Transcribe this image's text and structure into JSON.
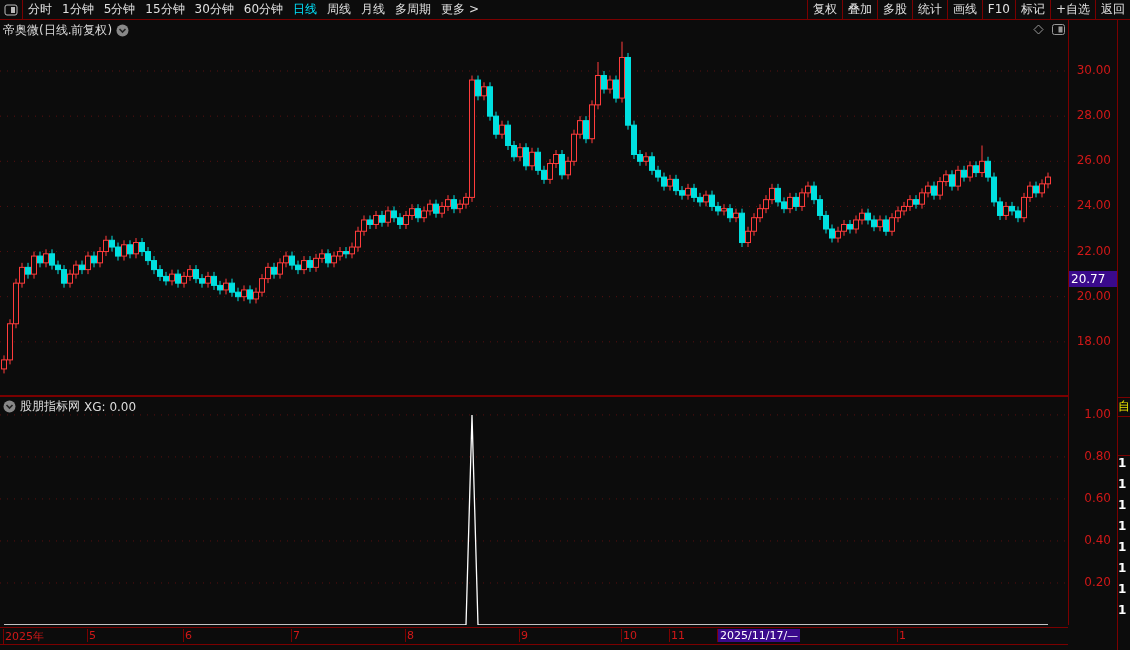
{
  "toolbar": {
    "periods": [
      {
        "label": "分时",
        "selected": false
      },
      {
        "label": "1分钟",
        "selected": false
      },
      {
        "label": "5分钟",
        "selected": false
      },
      {
        "label": "15分钟",
        "selected": false
      },
      {
        "label": "30分钟",
        "selected": false
      },
      {
        "label": "60分钟",
        "selected": false
      },
      {
        "label": "日线",
        "selected": true
      },
      {
        "label": "周线",
        "selected": false
      },
      {
        "label": "月线",
        "selected": false
      },
      {
        "label": "多周期",
        "selected": false
      },
      {
        "label": "更多 >",
        "selected": false
      }
    ],
    "actions": [
      "复权",
      "叠加",
      "多股",
      "统计",
      "画线",
      "F10",
      "标记",
      "+自选",
      "返回"
    ]
  },
  "main_panel": {
    "title": "帝奥微(日线.前复权)",
    "last_price": "20.77",
    "chart_data": {
      "type": "candlestick",
      "grid": true,
      "ylim": [
        15.6,
        32.26
      ],
      "yticks": [
        {
          "value": 30,
          "label": "30.00"
        },
        {
          "value": 28,
          "label": "28.00"
        },
        {
          "value": 26,
          "label": "26.00"
        },
        {
          "value": 24,
          "label": "24.00"
        },
        {
          "value": 22,
          "label": "22.00"
        },
        {
          "value": 20,
          "label": "20.00"
        },
        {
          "value": 18,
          "label": "18.00"
        }
      ],
      "ohlc": [
        [
          16.8,
          17.4,
          16.6,
          17.2
        ],
        [
          17.2,
          19.0,
          17.0,
          18.8
        ],
        [
          18.8,
          20.8,
          18.6,
          20.6
        ],
        [
          20.6,
          21.5,
          20.4,
          21.3
        ],
        [
          21.3,
          21.5,
          20.8,
          21.0
        ],
        [
          21.0,
          22.0,
          20.8,
          21.8
        ],
        [
          21.8,
          22.0,
          21.3,
          21.5
        ],
        [
          21.5,
          22.1,
          21.3,
          21.9
        ],
        [
          21.9,
          22.1,
          21.2,
          21.4
        ],
        [
          21.4,
          21.6,
          21.0,
          21.2
        ],
        [
          21.2,
          21.4,
          20.4,
          20.6
        ],
        [
          20.6,
          21.2,
          20.4,
          21.0
        ],
        [
          21.0,
          21.6,
          20.8,
          21.4
        ],
        [
          21.4,
          21.6,
          21.0,
          21.2
        ],
        [
          21.2,
          22.0,
          21.0,
          21.8
        ],
        [
          21.8,
          22.0,
          21.3,
          21.5
        ],
        [
          21.5,
          22.2,
          21.3,
          22.0
        ],
        [
          22.0,
          22.7,
          21.8,
          22.5
        ],
        [
          22.5,
          22.7,
          22.0,
          22.2
        ],
        [
          22.2,
          22.4,
          21.6,
          21.8
        ],
        [
          21.8,
          22.5,
          21.6,
          22.3
        ],
        [
          22.3,
          22.5,
          21.7,
          21.9
        ],
        [
          21.9,
          22.6,
          21.7,
          22.4
        ],
        [
          22.4,
          22.6,
          21.8,
          22.0
        ],
        [
          22.0,
          22.2,
          21.4,
          21.6
        ],
        [
          21.6,
          21.8,
          21.0,
          21.2
        ],
        [
          21.2,
          21.4,
          20.7,
          20.9
        ],
        [
          20.9,
          21.1,
          20.5,
          20.7
        ],
        [
          20.7,
          21.2,
          20.5,
          21.0
        ],
        [
          21.0,
          21.2,
          20.4,
          20.6
        ],
        [
          20.6,
          21.1,
          20.4,
          20.9
        ],
        [
          20.9,
          21.4,
          20.7,
          21.2
        ],
        [
          21.2,
          21.4,
          20.6,
          20.8
        ],
        [
          20.8,
          21.0,
          20.4,
          20.6
        ],
        [
          20.6,
          21.1,
          20.4,
          20.9
        ],
        [
          20.9,
          21.1,
          20.3,
          20.5
        ],
        [
          20.5,
          20.7,
          20.1,
          20.3
        ],
        [
          20.3,
          20.8,
          20.1,
          20.6
        ],
        [
          20.6,
          20.8,
          20.0,
          20.2
        ],
        [
          20.2,
          20.4,
          19.8,
          20.0
        ],
        [
          20.0,
          20.5,
          19.8,
          20.3
        ],
        [
          20.3,
          20.5,
          19.7,
          19.9
        ],
        [
          19.9,
          20.4,
          19.7,
          20.2
        ],
        [
          20.2,
          21.0,
          20.0,
          20.8
        ],
        [
          20.8,
          21.5,
          20.6,
          21.3
        ],
        [
          21.3,
          21.5,
          20.8,
          21.0
        ],
        [
          21.0,
          21.7,
          20.8,
          21.5
        ],
        [
          21.5,
          22.0,
          21.3,
          21.8
        ],
        [
          21.8,
          22.0,
          21.2,
          21.4
        ],
        [
          21.4,
          21.6,
          21.0,
          21.2
        ],
        [
          21.2,
          21.8,
          21.0,
          21.6
        ],
        [
          21.6,
          21.8,
          21.1,
          21.3
        ],
        [
          21.3,
          21.9,
          21.1,
          21.7
        ],
        [
          21.7,
          22.1,
          21.5,
          21.9
        ],
        [
          21.9,
          22.1,
          21.3,
          21.5
        ],
        [
          21.5,
          22.0,
          21.3,
          21.8
        ],
        [
          21.8,
          22.2,
          21.6,
          22.0
        ],
        [
          22.0,
          22.2,
          21.7,
          21.9
        ],
        [
          21.9,
          22.4,
          21.7,
          22.2
        ],
        [
          22.2,
          23.1,
          22.0,
          22.9
        ],
        [
          22.9,
          23.6,
          22.7,
          23.4
        ],
        [
          23.4,
          23.6,
          23.0,
          23.2
        ],
        [
          23.2,
          23.8,
          23.0,
          23.6
        ],
        [
          23.6,
          23.8,
          23.1,
          23.3
        ],
        [
          23.3,
          24.0,
          23.1,
          23.8
        ],
        [
          23.8,
          24.0,
          23.3,
          23.5
        ],
        [
          23.5,
          23.7,
          23.0,
          23.2
        ],
        [
          23.2,
          23.8,
          23.0,
          23.6
        ],
        [
          23.6,
          24.1,
          23.4,
          23.9
        ],
        [
          23.9,
          24.1,
          23.3,
          23.5
        ],
        [
          23.5,
          24.0,
          23.3,
          23.8
        ],
        [
          23.8,
          24.3,
          23.6,
          24.1
        ],
        [
          24.1,
          24.3,
          23.5,
          23.7
        ],
        [
          23.7,
          24.2,
          23.5,
          24.0
        ],
        [
          24.0,
          24.5,
          23.8,
          24.3
        ],
        [
          24.3,
          24.5,
          23.7,
          23.9
        ],
        [
          23.9,
          24.3,
          23.7,
          24.1
        ],
        [
          24.1,
          24.6,
          23.9,
          24.4
        ],
        [
          24.4,
          29.8,
          24.2,
          29.6
        ],
        [
          29.6,
          29.8,
          28.7,
          28.9
        ],
        [
          28.9,
          29.5,
          28.7,
          29.3
        ],
        [
          29.3,
          29.5,
          27.8,
          28.0
        ],
        [
          28.0,
          28.2,
          27.0,
          27.2
        ],
        [
          27.2,
          27.8,
          27.0,
          27.6
        ],
        [
          27.6,
          27.8,
          26.5,
          26.7
        ],
        [
          26.7,
          26.9,
          26.0,
          26.2
        ],
        [
          26.2,
          26.8,
          26.0,
          26.6
        ],
        [
          26.6,
          26.8,
          25.6,
          25.8
        ],
        [
          25.8,
          26.6,
          25.6,
          26.4
        ],
        [
          26.4,
          26.6,
          25.4,
          25.6
        ],
        [
          25.6,
          25.8,
          25.0,
          25.2
        ],
        [
          25.2,
          26.1,
          25.0,
          25.9
        ],
        [
          25.9,
          26.5,
          25.7,
          26.3
        ],
        [
          26.3,
          26.5,
          25.2,
          25.4
        ],
        [
          25.4,
          26.2,
          25.2,
          26.0
        ],
        [
          26.0,
          27.4,
          25.8,
          27.2
        ],
        [
          27.2,
          28.0,
          27.0,
          27.8
        ],
        [
          27.8,
          28.0,
          26.8,
          27.0
        ],
        [
          27.0,
          28.7,
          26.8,
          28.5
        ],
        [
          28.5,
          30.4,
          28.3,
          29.8
        ],
        [
          29.8,
          30.0,
          29.0,
          29.2
        ],
        [
          29.2,
          29.8,
          29.0,
          29.6
        ],
        [
          29.6,
          29.8,
          28.6,
          28.8
        ],
        [
          28.8,
          31.3,
          28.6,
          30.6
        ],
        [
          30.6,
          30.8,
          27.4,
          27.6
        ],
        [
          27.6,
          27.8,
          26.1,
          26.3
        ],
        [
          26.3,
          26.5,
          25.8,
          26.0
        ],
        [
          26.0,
          26.4,
          25.8,
          26.2
        ],
        [
          26.2,
          26.4,
          25.4,
          25.6
        ],
        [
          25.6,
          25.8,
          25.1,
          25.3
        ],
        [
          25.3,
          25.5,
          24.7,
          24.9
        ],
        [
          24.9,
          25.4,
          24.7,
          25.2
        ],
        [
          25.2,
          25.4,
          24.5,
          24.7
        ],
        [
          24.7,
          24.9,
          24.3,
          24.5
        ],
        [
          24.5,
          25.0,
          24.3,
          24.8
        ],
        [
          24.8,
          25.0,
          24.2,
          24.4
        ],
        [
          24.4,
          24.6,
          24.0,
          24.2
        ],
        [
          24.2,
          24.7,
          24.0,
          24.5
        ],
        [
          24.5,
          24.7,
          23.8,
          24.0
        ],
        [
          24.0,
          24.2,
          23.6,
          23.8
        ],
        [
          23.8,
          24.1,
          23.6,
          23.9
        ],
        [
          23.9,
          24.1,
          23.3,
          23.5
        ],
        [
          23.5,
          23.9,
          23.3,
          23.7
        ],
        [
          23.7,
          23.9,
          22.2,
          22.4
        ],
        [
          22.4,
          23.1,
          22.2,
          22.9
        ],
        [
          22.9,
          23.7,
          22.7,
          23.5
        ],
        [
          23.5,
          24.1,
          23.3,
          23.9
        ],
        [
          23.9,
          24.5,
          23.7,
          24.3
        ],
        [
          24.3,
          25.0,
          24.1,
          24.8
        ],
        [
          24.8,
          25.0,
          24.0,
          24.2
        ],
        [
          24.2,
          24.4,
          23.7,
          23.9
        ],
        [
          23.9,
          24.6,
          23.7,
          24.4
        ],
        [
          24.4,
          24.6,
          23.8,
          24.0
        ],
        [
          24.0,
          24.8,
          23.8,
          24.6
        ],
        [
          24.6,
          25.1,
          24.4,
          24.9
        ],
        [
          24.9,
          25.1,
          24.1,
          24.3
        ],
        [
          24.3,
          24.5,
          23.4,
          23.6
        ],
        [
          23.6,
          23.8,
          22.8,
          23.0
        ],
        [
          23.0,
          23.2,
          22.4,
          22.6
        ],
        [
          22.6,
          23.1,
          22.4,
          22.9
        ],
        [
          22.9,
          23.4,
          22.7,
          23.2
        ],
        [
          23.2,
          23.4,
          22.8,
          23.0
        ],
        [
          23.0,
          23.6,
          22.8,
          23.4
        ],
        [
          23.4,
          23.9,
          23.2,
          23.7
        ],
        [
          23.7,
          23.9,
          23.2,
          23.4
        ],
        [
          23.4,
          23.6,
          22.9,
          23.1
        ],
        [
          23.1,
          23.6,
          22.9,
          23.4
        ],
        [
          23.4,
          23.6,
          22.7,
          22.9
        ],
        [
          22.9,
          23.7,
          22.7,
          23.5
        ],
        [
          23.5,
          24.0,
          23.3,
          23.8
        ],
        [
          23.8,
          24.2,
          23.6,
          24.0
        ],
        [
          24.0,
          24.5,
          23.8,
          24.3
        ],
        [
          24.3,
          24.5,
          23.9,
          24.1
        ],
        [
          24.1,
          24.8,
          23.9,
          24.6
        ],
        [
          24.6,
          25.1,
          24.4,
          24.9
        ],
        [
          24.9,
          25.1,
          24.3,
          24.5
        ],
        [
          24.5,
          25.3,
          24.3,
          25.1
        ],
        [
          25.1,
          25.6,
          24.9,
          25.4
        ],
        [
          25.4,
          25.6,
          24.7,
          24.9
        ],
        [
          24.9,
          25.8,
          24.7,
          25.6
        ],
        [
          25.6,
          25.8,
          25.1,
          25.3
        ],
        [
          25.3,
          26.0,
          25.1,
          25.8
        ],
        [
          25.8,
          26.0,
          25.3,
          25.5
        ],
        [
          25.5,
          26.7,
          25.3,
          26.0
        ],
        [
          26.0,
          26.2,
          25.1,
          25.3
        ],
        [
          25.3,
          25.5,
          24.0,
          24.2
        ],
        [
          24.2,
          24.4,
          23.4,
          23.6
        ],
        [
          23.6,
          24.2,
          23.4,
          24.0
        ],
        [
          24.0,
          24.2,
          23.6,
          23.8
        ],
        [
          23.8,
          24.0,
          23.3,
          23.5
        ],
        [
          23.5,
          24.6,
          23.3,
          24.4
        ],
        [
          24.4,
          25.1,
          24.2,
          24.9
        ],
        [
          24.9,
          25.1,
          24.4,
          24.6
        ],
        [
          24.6,
          25.2,
          24.4,
          25.0
        ],
        [
          25.0,
          25.5,
          24.8,
          25.3
        ]
      ]
    }
  },
  "indicator_panel": {
    "title": "股朋指标网",
    "reading": "XG: 0.00",
    "chart_data": {
      "type": "line",
      "grid": true,
      "ylim": [
        0,
        1.09
      ],
      "yticks": [
        {
          "value": 1,
          "label": "1.00"
        },
        {
          "value": 0.8,
          "label": "0.80"
        },
        {
          "value": 0.6,
          "label": "0.60"
        },
        {
          "value": 0.4,
          "label": "0.40"
        },
        {
          "value": 0.2,
          "label": "0.20"
        }
      ],
      "series": [
        {
          "color": "#ffffff",
          "values": [
            0,
            0,
            0,
            0,
            0,
            0,
            0,
            0,
            0,
            0,
            0,
            0,
            0,
            0,
            0,
            0,
            0,
            0,
            0,
            0,
            0,
            0,
            0,
            0,
            0,
            0,
            0,
            0,
            0,
            0,
            0,
            0,
            0,
            0,
            0,
            0,
            0,
            0,
            0,
            0,
            0,
            0,
            0,
            0,
            0,
            0,
            0,
            0,
            0,
            0,
            0,
            0,
            0,
            0,
            0,
            0,
            0,
            0,
            0,
            0,
            0,
            0,
            0,
            0,
            0,
            0,
            0,
            0,
            0,
            0,
            0,
            0,
            0,
            0,
            0,
            0,
            0,
            0,
            1,
            0,
            0,
            0,
            0,
            0,
            0,
            0,
            0,
            0,
            0,
            0,
            0,
            0,
            0,
            0,
            0,
            0,
            0,
            0,
            0,
            0,
            0,
            0,
            0,
            0,
            0,
            0,
            0,
            0,
            0,
            0,
            0,
            0,
            0,
            0,
            0,
            0,
            0,
            0,
            0,
            0,
            0,
            0,
            0,
            0,
            0,
            0,
            0,
            0,
            0,
            0,
            0,
            0,
            0,
            0,
            0,
            0,
            0,
            0,
            0,
            0,
            0,
            0,
            0,
            0,
            0,
            0,
            0,
            0,
            0,
            0,
            0,
            0,
            0,
            0,
            0,
            0,
            0,
            0,
            0,
            0,
            0,
            0,
            0,
            0,
            0,
            0,
            0,
            0,
            0,
            0,
            0,
            0,
            0,
            0,
            0
          ]
        }
      ]
    }
  },
  "time_axis": [
    {
      "label": "2025年",
      "selected": false
    },
    {
      "label": "5",
      "selected": false
    },
    {
      "label": "6",
      "selected": false
    },
    {
      "label": "7",
      "selected": false
    },
    {
      "label": "8",
      "selected": false
    },
    {
      "label": "9",
      "selected": false
    },
    {
      "label": "10",
      "selected": false
    },
    {
      "label": "11",
      "selected": false
    },
    {
      "label": "2025/11/17/—",
      "selected": true
    },
    {
      "label": "1",
      "selected": false
    }
  ],
  "side_strip": {
    "header": "自",
    "values": [
      "1",
      "1",
      "1",
      "1",
      "1",
      "1",
      "1",
      "1"
    ]
  }
}
